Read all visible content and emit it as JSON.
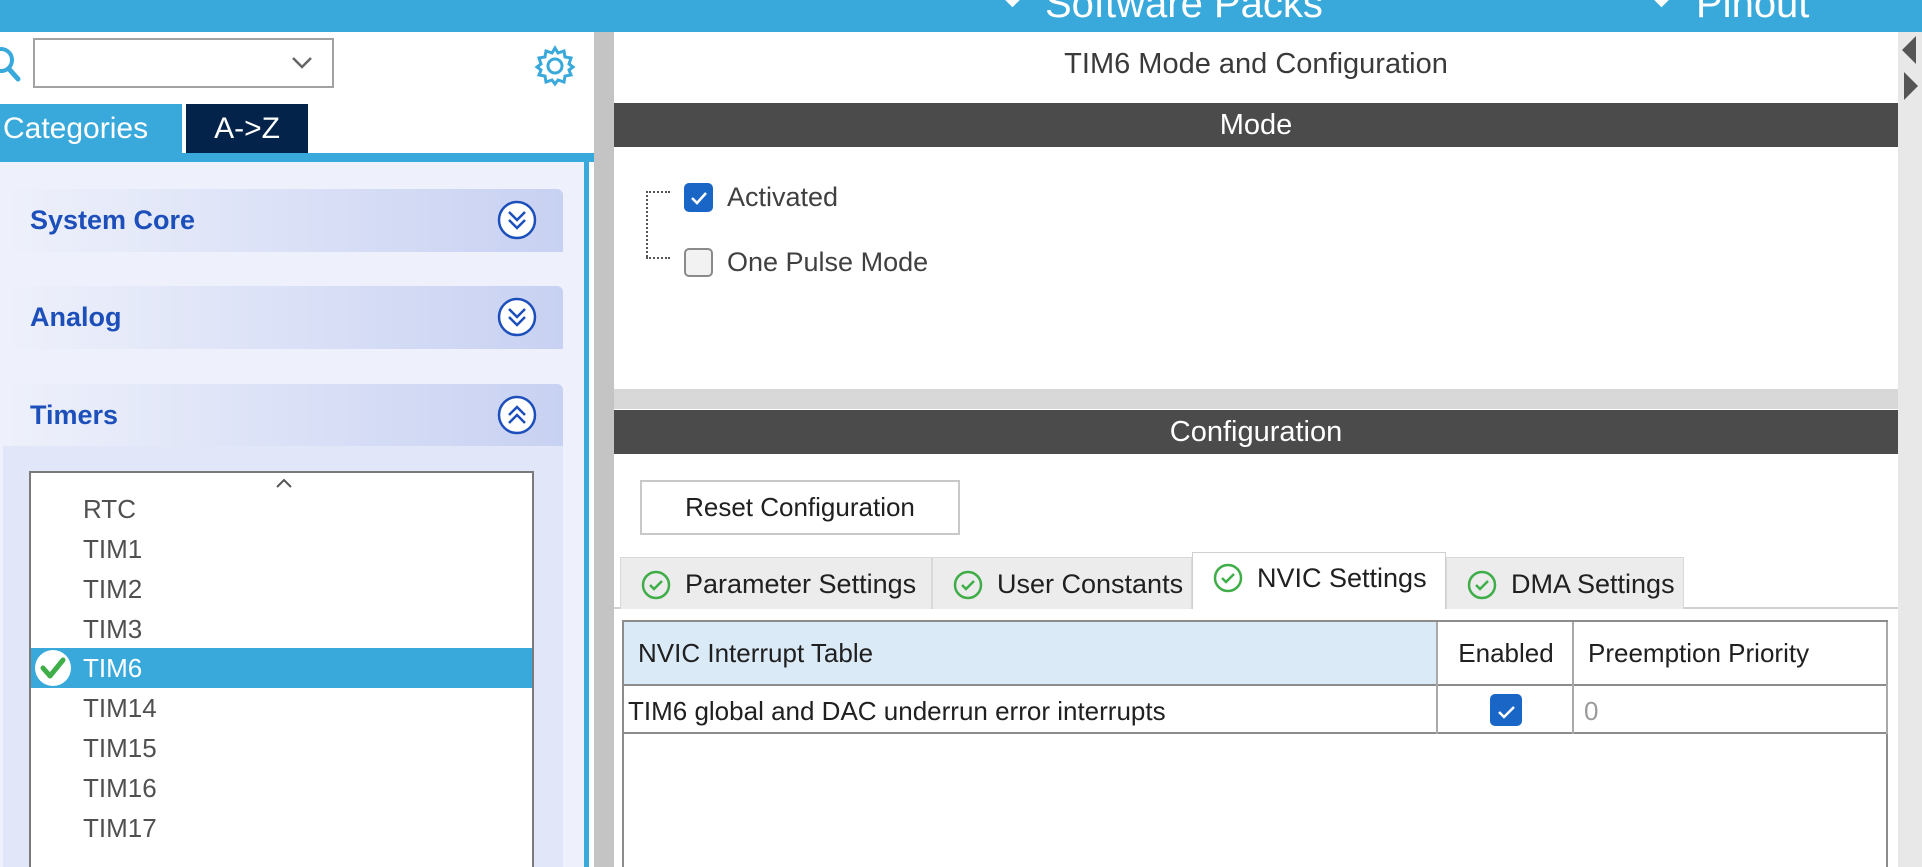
{
  "topbar": {
    "software_packs": "Software Packs",
    "pinout": "Pinout"
  },
  "left": {
    "search": {
      "value": "",
      "placeholder": ""
    },
    "tabs": [
      {
        "label": "Categories"
      },
      {
        "label": "A->Z"
      }
    ],
    "categories": [
      {
        "label": "System Core",
        "state": "collapsed"
      },
      {
        "label": "Analog",
        "state": "collapsed"
      },
      {
        "label": "Timers",
        "state": "expanded"
      }
    ],
    "timers": [
      "RTC",
      "TIM1",
      "TIM2",
      "TIM3",
      "TIM6",
      "TIM14",
      "TIM15",
      "TIM16",
      "TIM17"
    ],
    "selected_timer": "TIM6"
  },
  "main": {
    "title": "TIM6 Mode and Configuration",
    "mode_header": "Mode",
    "mode_options": [
      {
        "label": "Activated",
        "checked": true
      },
      {
        "label": "One Pulse Mode",
        "checked": false
      }
    ],
    "config_header": "Configuration",
    "reset_label": "Reset Configuration",
    "tabs": [
      {
        "label": "Parameter Settings"
      },
      {
        "label": "User Constants"
      },
      {
        "label": "NVIC Settings",
        "active": true
      },
      {
        "label": "DMA Settings"
      }
    ],
    "table": {
      "headers": [
        "NVIC Interrupt Table",
        "Enabled",
        "Preemption Priority"
      ],
      "rows": [
        {
          "name": "TIM6 global and DAC underrun error interrupts",
          "enabled": true,
          "priority": "0"
        }
      ]
    }
  },
  "colors": {
    "accent": "#39a9db",
    "dark_tab": "#03234b",
    "category_text": "#1d4fbb",
    "section_bar": "#4b4b4b",
    "check_blue": "#1a66c7",
    "check_green": "#3fae49"
  }
}
